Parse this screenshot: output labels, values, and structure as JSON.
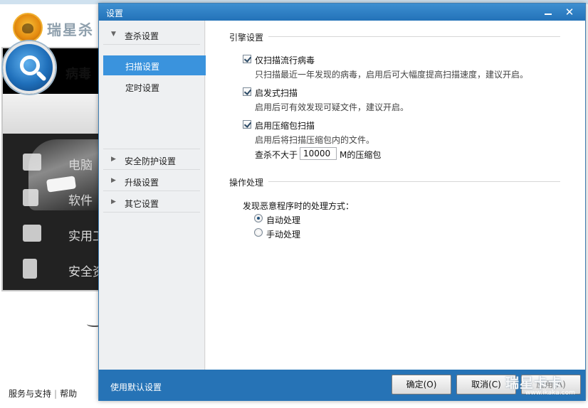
{
  "background_app": {
    "brand": "瑞星杀",
    "virus_label": "病毒",
    "menu": [
      {
        "icon": "monitor-icon",
        "label": "电脑"
      },
      {
        "icon": "upload-arrow-icon",
        "label": "软件"
      },
      {
        "icon": "toolbox-icon",
        "label": "实用工"
      },
      {
        "icon": "document-list-icon",
        "label": "安全资"
      }
    ],
    "footer": {
      "support": "服务与支持",
      "separator": "|",
      "help": "帮助"
    }
  },
  "dialog": {
    "title": "设置",
    "minimize": "",
    "close": "✕",
    "nav": {
      "scan_settings": "查杀设置",
      "scan": "扫描设置",
      "scheduled": "定时设置",
      "protection": "安全防护设置",
      "upgrade": "升级设置",
      "other": "其它设置",
      "expanded_arrow": "▼",
      "collapsed_arrow": "▶"
    },
    "engine": {
      "title": "引擎设置",
      "options": [
        {
          "label": "仅扫描流行病毒",
          "desc": "只扫描最近一年发现的病毒，启用后可大幅度提高扫描速度，建议开启。",
          "checked": true
        },
        {
          "label": "启发式扫描",
          "desc": "启用后可有效发现可疑文件，建议开启。",
          "checked": true
        },
        {
          "label": "启用压缩包扫描",
          "desc": "启用后将扫描压缩包内的文件。",
          "checked": true
        }
      ],
      "size_prefix": "查杀不大于",
      "size_value": "10000",
      "size_suffix": "M的压缩包"
    },
    "action": {
      "title": "操作处理",
      "question": "发现恶意程序时的处理方式：",
      "auto": "自动处理",
      "manual": "手动处理",
      "selected": "auto"
    },
    "footer": {
      "default_link": "使用默认设置",
      "ok": "确定(O)",
      "cancel": "取消(C)",
      "apply": "应用(A)"
    }
  },
  "watermark": {
    "main": "瑞星卡卡",
    "url": "www.ikaka.com"
  },
  "colors": {
    "title_bar": "#2372b8",
    "nav_active": "#3a93dd",
    "footer_bar": "#2673b6"
  }
}
